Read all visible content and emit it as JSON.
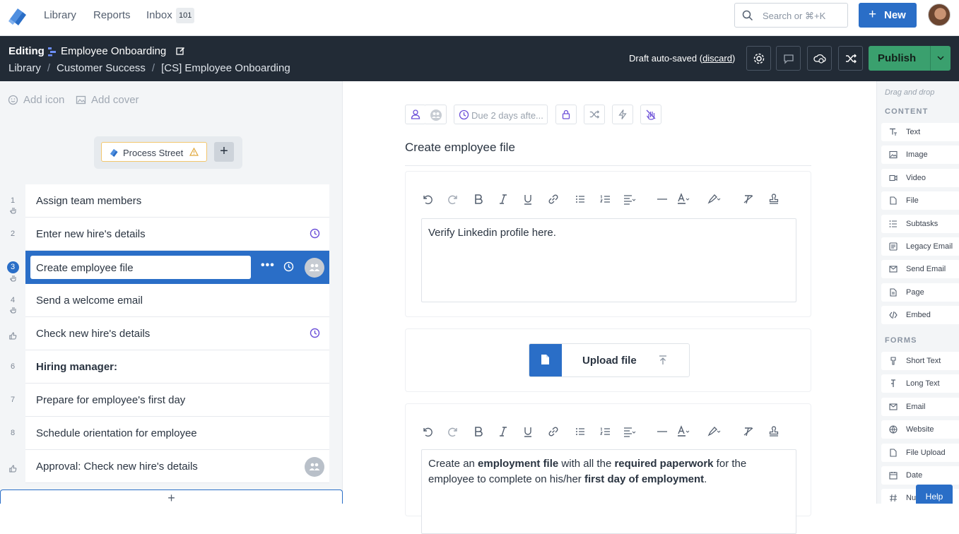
{
  "nav": {
    "links": [
      "Library",
      "Reports",
      "Inbox"
    ],
    "inbox_count": "101",
    "search_placeholder": "Search or ⌘+K",
    "new_label": "New"
  },
  "editbar": {
    "mode": "Editing",
    "workflow_name": "Employee Onboarding",
    "breadcrumb": [
      "Library",
      "Customer Success",
      "[CS] Employee Onboarding"
    ],
    "autosave_text": "Draft auto-saved",
    "discard_label": "discard",
    "publish_label": "Publish"
  },
  "left": {
    "add_icon": "Add icon",
    "add_cover": "Add cover",
    "trigger_chip": "Process Street",
    "tasks": [
      {
        "num": "1",
        "name": "Assign team members",
        "marker": "hand"
      },
      {
        "num": "2",
        "name": "Enter new hire's details",
        "marker": "",
        "clock": true
      },
      {
        "num": "3",
        "name": "Create employee file",
        "marker": "hand",
        "active": true
      },
      {
        "num": "4",
        "name": "Send a welcome email",
        "marker": "hand"
      },
      {
        "num": "",
        "name": "Check new hire's details",
        "marker": "thumb",
        "clock": true
      },
      {
        "num": "6",
        "name": "Hiring manager:",
        "marker": "",
        "bold": true
      },
      {
        "num": "7",
        "name": "Prepare for employee's first day",
        "marker": ""
      },
      {
        "num": "8",
        "name": "Schedule orientation for employee",
        "marker": ""
      },
      {
        "num": "",
        "name": "Approval: Check new hire's details",
        "marker": "thumb",
        "group": true
      }
    ]
  },
  "main": {
    "due_label": "Due 2 days afte...",
    "step_title": "Create employee file",
    "text_block_1": "Verify Linkedin profile here.",
    "upload_label": "Upload file",
    "text_block_2": {
      "t1": "Create an ",
      "b1": "employment file",
      "t2": " with all the ",
      "b2": "required paperwork",
      "t3": " for the employee to complete on his/her ",
      "b3": "first day of employment",
      "t4": "."
    }
  },
  "sidebar": {
    "drag_drop": "Drag and drop",
    "content_heading": "CONTENT",
    "content_items": [
      "Text",
      "Image",
      "Video",
      "File",
      "Subtasks",
      "Legacy Email",
      "Send Email",
      "Page",
      "Embed"
    ],
    "forms_heading": "FORMS",
    "form_items": [
      "Short Text",
      "Long Text",
      "Email",
      "Website",
      "File Upload",
      "Date",
      "Nu"
    ]
  },
  "help_label": "Help",
  "colors": {
    "primary": "#2a6ec7",
    "dark_bar": "#222b36",
    "publish": "#3aa06e",
    "warning": "#f2c66d"
  }
}
